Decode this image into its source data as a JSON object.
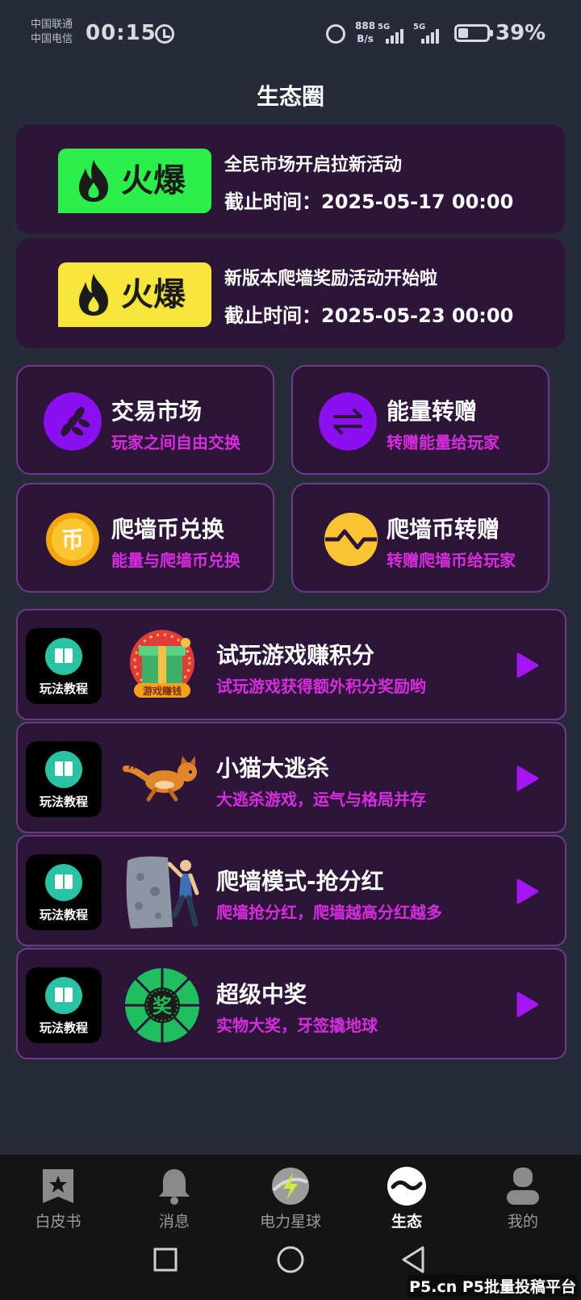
{
  "status_bar": {
    "carrier_1": "中国联通",
    "carrier_2": "中国电信",
    "time": "00:15",
    "net_speed_value": "888",
    "net_speed_unit": "B/s",
    "signal_1": "5G",
    "signal_2": "5G",
    "battery": "39%"
  },
  "header": {
    "title": "生态圈"
  },
  "promos": [
    {
      "badge": "火爆",
      "badge_color": "#2bf04b",
      "title": "全民市场开启拉新活动",
      "deadline": "截止时间：2025-05-17 00:00"
    },
    {
      "badge": "火爆",
      "badge_color": "#f7e53a",
      "title": "新版本爬墙奖励活动开始啦",
      "deadline": "截止时间：2025-05-23 00:00"
    }
  ],
  "features": [
    {
      "icon": "leaf-icon",
      "title": "交易市场",
      "subtitle": "玩家之间自由交换"
    },
    {
      "icon": "transfer-icon",
      "title": "能量转赠",
      "subtitle": "转赠能量给玩家"
    },
    {
      "icon": "coin-icon",
      "title": "爬墙币兑换",
      "subtitle": "能量与爬墙币兑换",
      "coin_char": "币"
    },
    {
      "icon": "coin-transfer-icon",
      "title": "爬墙币转赠",
      "subtitle": "转赠爬墙币给玩家"
    }
  ],
  "games": [
    {
      "tutorial": "玩法教程",
      "art": "gift-box-icon",
      "art_label": "游戏赚钱",
      "title": "试玩游戏赚积分",
      "subtitle": "试玩游戏获得额外积分奖励哟"
    },
    {
      "tutorial": "玩法教程",
      "art": "running-cat-icon",
      "title": "小猫大逃杀",
      "subtitle": "大逃杀游戏，运气与格局并存"
    },
    {
      "tutorial": "玩法教程",
      "art": "climber-icon",
      "title": "爬墙模式-抢分红",
      "subtitle": "爬墙抢分红，爬墙越高分红越多"
    },
    {
      "tutorial": "玩法教程",
      "art": "prize-wheel-icon",
      "art_label": "奖",
      "title": "超级中奖",
      "subtitle": "实物大奖，牙签撬地球"
    }
  ],
  "bottom_nav": [
    {
      "icon": "whitepaper-icon",
      "label": "白皮书",
      "active": false
    },
    {
      "icon": "bell-icon",
      "label": "消息",
      "active": false
    },
    {
      "icon": "power-planet-icon",
      "label": "电力星球",
      "active": false
    },
    {
      "icon": "ecosystem-icon",
      "label": "生态",
      "active": true
    },
    {
      "icon": "profile-icon",
      "label": "我的",
      "active": false
    }
  ],
  "watermark": "P5.cn P5批量投稿平台",
  "colors": {
    "background": "#262a39",
    "card": "#2c1538",
    "card_border": "#6e3a8c",
    "accent_purple": "#8b10f0",
    "subtitle_magenta": "#d92ce0"
  }
}
